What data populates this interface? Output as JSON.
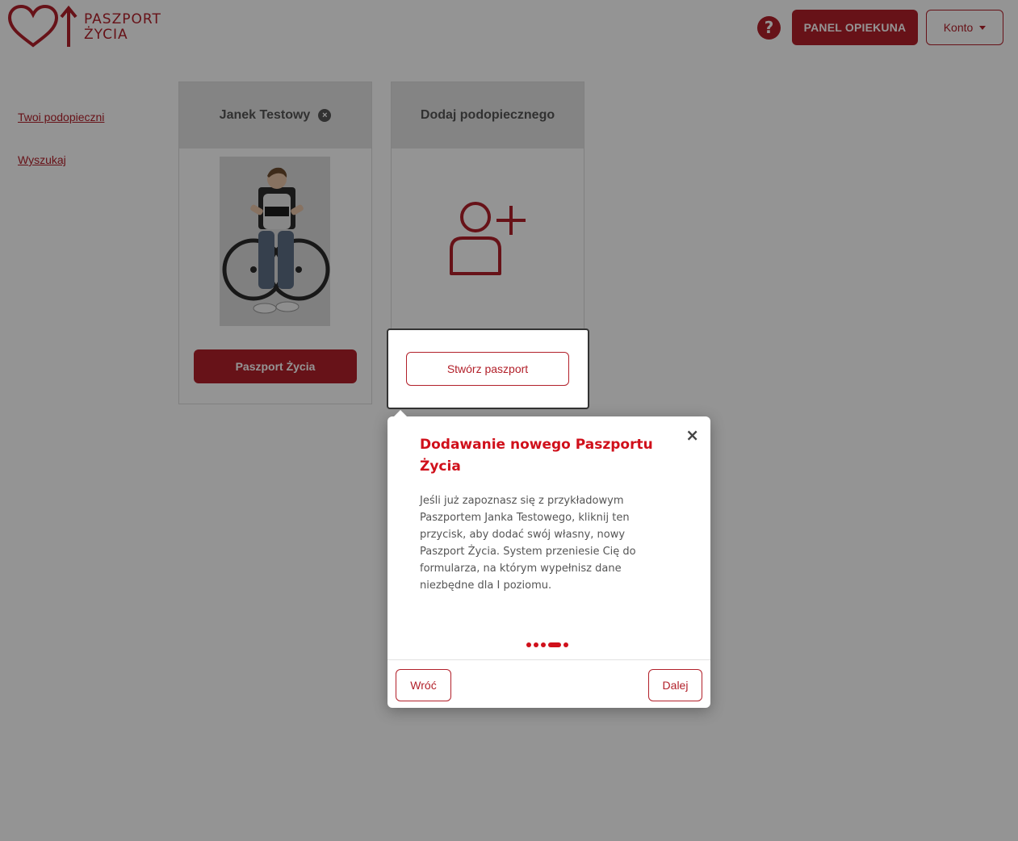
{
  "header": {
    "logo_line1": "PASZPORT",
    "logo_line2": "ŻYCIA",
    "help_symbol": "?",
    "panel_button": "PANEL OPIEKUNA",
    "account_button": "Konto"
  },
  "sidebar": {
    "items": [
      {
        "label": "Twoi podopieczni"
      },
      {
        "label": "Wyszukaj"
      }
    ]
  },
  "cards": [
    {
      "name": "Janek Testowy",
      "remove_symbol": "×",
      "button": "Paszport Życia"
    },
    {
      "name": "Dodaj podopiecznego",
      "button": "Stwórz paszport"
    }
  ],
  "tour": {
    "title": "Dodawanie nowego Paszportu Życia",
    "close_symbol": "×",
    "body": "Jeśli już zapoznasz się z przykładowym Paszportem Janka Testowego, kliknij ten przycisk, aby dodać swój własny, nowy Paszport Życia. System przeniesie Cię do formularza, na którym wypełnisz dane niezbędne dla I poziomu.",
    "steps_total": 5,
    "step_current": 4,
    "back_button": "Wróć",
    "next_button": "Dalej"
  },
  "colors": {
    "brand": "#b2202a",
    "tour_accent": "#d0101b"
  }
}
